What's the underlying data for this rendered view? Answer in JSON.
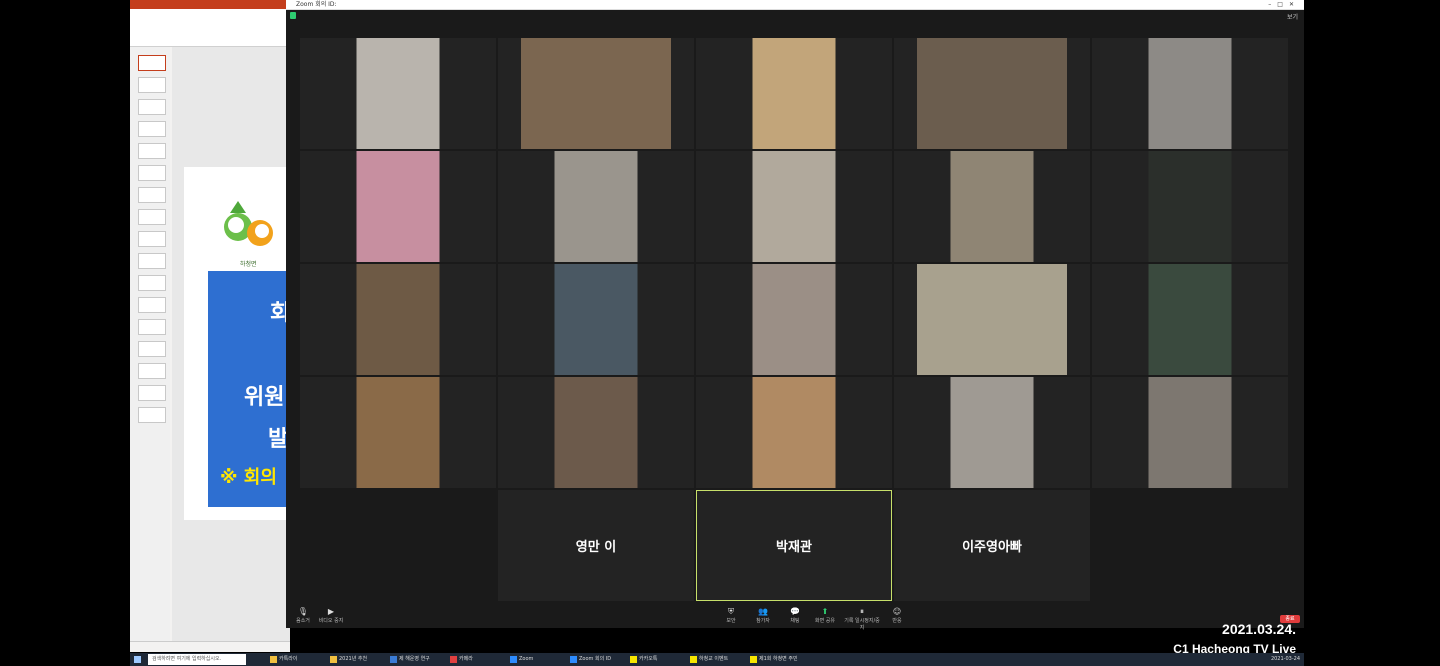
{
  "zoom": {
    "window_title": "Zoom 회의 ID:",
    "view_label": "보기",
    "participants": [
      {
        "name": "",
        "bg": "#b9b4ad"
      },
      {
        "name": "",
        "bg": "#7b6650"
      },
      {
        "name": "",
        "bg": "#c2a57a"
      },
      {
        "name": "",
        "bg": "#6b5d4e"
      },
      {
        "name": "",
        "bg": "#8d8a86"
      },
      {
        "name": "",
        "bg": "#c78fa0"
      },
      {
        "name": "",
        "bg": "#9a958d"
      },
      {
        "name": "",
        "bg": "#b1a99c"
      },
      {
        "name": "",
        "bg": "#8f8574"
      },
      {
        "name": "",
        "bg": "#2b2f2b"
      },
      {
        "name": "",
        "bg": "#6e5a45"
      },
      {
        "name": "",
        "bg": "#4a5863"
      },
      {
        "name": "",
        "bg": "#9b8f86"
      },
      {
        "name": "",
        "bg": "#a8a18e"
      },
      {
        "name": "",
        "bg": "#3a4a3e"
      },
      {
        "name": "",
        "bg": "#8a6a48"
      },
      {
        "name": "",
        "bg": "#6c5a4b"
      },
      {
        "name": "",
        "bg": "#b08a63"
      },
      {
        "name": "",
        "bg": "#9f9a93"
      },
      {
        "name": "",
        "bg": "#7d7770"
      }
    ],
    "name_tiles": [
      {
        "label": "영만 이",
        "active": false
      },
      {
        "label": "박재관",
        "active": true
      },
      {
        "label": "이주영아빠",
        "active": false
      }
    ],
    "toolbar": {
      "mute": "음소거",
      "video": "비디오 중지",
      "security": "보안",
      "participants": "참가자",
      "chat": "채팅",
      "share": "화면 공유",
      "record": "기록 일시정지/중지",
      "reactions": "반응",
      "leave": "종료"
    }
  },
  "overlay": {
    "date": "2021.03.24.",
    "channel": "C1 Hacheong TV Live"
  },
  "ppt": {
    "slide_lines": [
      "회",
      "위원",
      "발",
      "※ 회의"
    ],
    "logo_caption": "하청면"
  },
  "taskbar": {
    "search_placeholder": "검색하려면 여기에 입력하십시오.",
    "apps": [
      "카톡라이",
      "2021년 추천",
      "제 해운영 연구",
      "카메라",
      "Zoom",
      "Zoom 회의 ID",
      "카카오톡",
      "하청교 이벤트",
      "제1회 하청면 주민"
    ],
    "clock": "2021-03-24"
  },
  "colors": {
    "accent": "#c7e06a",
    "record": "#e03c3c",
    "ppt": "#c43e1c",
    "slide_blue": "#2e6fd1"
  }
}
